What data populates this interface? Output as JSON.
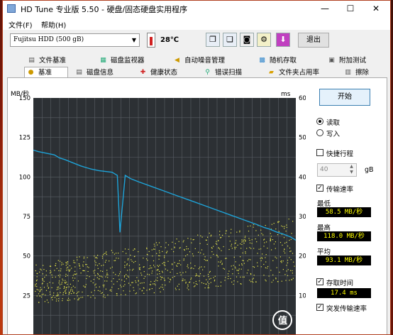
{
  "window": {
    "title": "HD Tune 专业版 5.50 - 硬盘/固态硬盘实用程序"
  },
  "menu": {
    "file": "文件(F)",
    "help": "帮助(H)"
  },
  "toolbar": {
    "drive": "Fujitsu HDD (500 gB)",
    "temperature": "28℃",
    "exit_label": "退出",
    "buttons": [
      "copy-icon",
      "copy-all-icon",
      "camera-icon",
      "options-icon",
      "download-icon"
    ]
  },
  "tabs_row1": [
    "文件基准",
    "磁盘监视器",
    "自动噪音管理",
    "随机存取",
    "附加测试"
  ],
  "tabs_row2": [
    "基准",
    "磁盘信息",
    "健康状态",
    "错误扫描",
    "文件夹占用率",
    "擦除"
  ],
  "controls": {
    "start": "开始",
    "read": "读取",
    "write": "写入",
    "short_stroke": "快捷行程",
    "short_stroke_value": "40",
    "short_stroke_unit": "gB",
    "transfer_rate": "传输速率",
    "min_label": "最低",
    "min_value": "58.5 MB/秒",
    "max_label": "最高",
    "max_value": "118.0 MB/秒",
    "avg_label": "平均",
    "avg_value": "93.1 MB/秒",
    "access_time_label": "存取时间",
    "access_time_value": "17.4 ms",
    "burst_label": "突发传输速率"
  },
  "watermark": "值 什么值得买",
  "chart_data": {
    "type": "line",
    "ylabel_left": "MB/秒",
    "ylabel_right": "ms",
    "y_left_ticks": [
      150,
      125,
      100,
      75,
      50,
      25
    ],
    "y_right_ticks": [
      60,
      50,
      40,
      30,
      20,
      10
    ],
    "ylim_left": [
      0,
      150
    ],
    "ylim_right": [
      0,
      60
    ],
    "grid": true,
    "series": [
      {
        "name": "传输速率",
        "color": "#1ea3d8",
        "x": [
          0,
          2,
          5,
          8,
          10,
          12,
          15,
          18,
          20,
          22,
          25,
          30,
          32,
          33,
          35,
          37,
          40,
          45,
          50,
          55,
          60,
          65,
          70,
          75,
          80,
          85,
          88,
          90,
          93,
          95,
          98,
          100
        ],
        "values": [
          117,
          116,
          115,
          114,
          112,
          111,
          109,
          107,
          106,
          105,
          104,
          103,
          101,
          65,
          101,
          99,
          97,
          94,
          91,
          88,
          85,
          82,
          79,
          76,
          73,
          70,
          68,
          67,
          65,
          64,
          62,
          60
        ]
      },
      {
        "name": "存取时间",
        "color": "#e6e64a",
        "type": "scatter",
        "band_ms": [
          8,
          24
        ]
      }
    ]
  }
}
